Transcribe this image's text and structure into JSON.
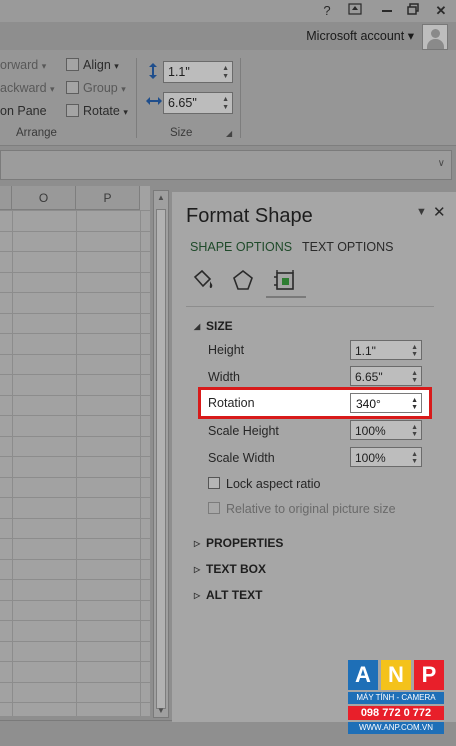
{
  "titlebar": {
    "help_icon": "question-icon",
    "buttons": [
      "ribbon-display-icon",
      "minimize-icon",
      "restore-icon",
      "close-icon"
    ]
  },
  "account": {
    "label": "Microsoft account",
    "caret": "▾"
  },
  "ribbon": {
    "arrange": {
      "items": [
        {
          "label": "orward",
          "dim": true
        },
        {
          "label": "ackward",
          "dim": true
        },
        {
          "label": "on Pane",
          "dim": false
        }
      ],
      "align": {
        "label": "Align",
        "caret": "▾"
      },
      "group": {
        "label": "Group",
        "caret": "▾"
      },
      "rotate": {
        "label": "Rotate",
        "caret": "▾"
      },
      "group_label": "Arrange"
    },
    "size": {
      "height_value": "1.1\"",
      "width_value": "6.65\"",
      "group_label": "Size"
    }
  },
  "grid": {
    "columns": [
      "O",
      "P"
    ]
  },
  "pane": {
    "title": "Format Shape",
    "tabs": {
      "shape": "SHAPE OPTIONS",
      "text": "TEXT OPTIONS"
    },
    "category_icons": [
      "fill-line-icon",
      "effects-pentagon-icon",
      "size-properties-icon"
    ],
    "size_section": {
      "header": "SIZE",
      "rows": [
        {
          "label": "Height",
          "value": "1.1\""
        },
        {
          "label": "Width",
          "value": "6.65\""
        },
        {
          "label": "Rotation",
          "value": "340°"
        },
        {
          "label": "Scale Height",
          "value": "100%"
        },
        {
          "label": "Scale Width",
          "value": "100%"
        }
      ],
      "lock_aspect": "Lock aspect ratio",
      "relative_original": "Relative to original picture size"
    },
    "sections": [
      "PROPERTIES",
      "TEXT BOX",
      "ALT TEXT"
    ]
  },
  "watermark": {
    "letters": [
      "A",
      "N",
      "P"
    ],
    "tagline": "MÁY TÍNH - CAMERA",
    "phone": "098 772 0 772",
    "website": "WWW.ANP.COM.VN",
    "colors": {
      "blue": "#1e6fb7",
      "red": "#e81f2a",
      "yellow": "#f4c21b"
    }
  }
}
